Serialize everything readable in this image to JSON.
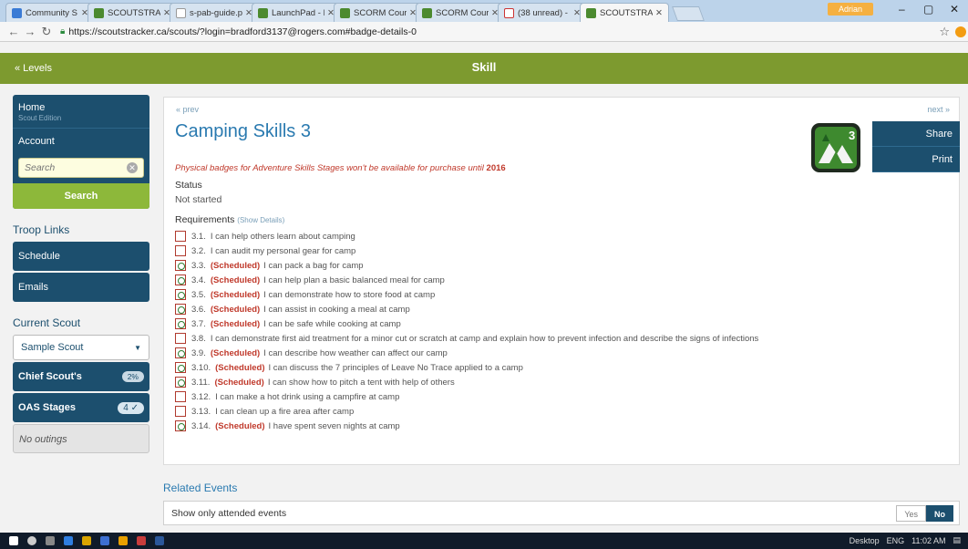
{
  "browser": {
    "tabs": [
      {
        "title": "Community S",
        "icon": "blue"
      },
      {
        "title": "SCOUTSTRAC",
        "icon": "green"
      },
      {
        "title": "s-pab-guide.p",
        "icon": "gray"
      },
      {
        "title": "LaunchPad - I",
        "icon": "green"
      },
      {
        "title": "SCORM Cours",
        "icon": "green"
      },
      {
        "title": "SCORM Cours",
        "icon": "green"
      },
      {
        "title": "(38 unread) -",
        "icon": "mail"
      },
      {
        "title": "SCOUTSTRAC",
        "icon": "green",
        "active": true
      }
    ],
    "profile": "Adrian",
    "url": "https://scoutstracker.ca/scouts/?login=bradford3137@rogers.com#badge-details-0"
  },
  "header": {
    "back": "« Levels",
    "title": "Skill"
  },
  "sidebar": {
    "home": "Home",
    "edition": "Scout Edition",
    "account": "Account",
    "search_placeholder": "Search",
    "search_button": "Search",
    "troop_links_heading": "Troop Links",
    "troop_links": [
      "Schedule",
      "Emails"
    ],
    "current_scout_heading": "Current Scout",
    "scout_selected": "Sample Scout",
    "chief_scouts": "Chief Scout's",
    "chief_scouts_pill": "2%",
    "oas_stages": "OAS Stages",
    "oas_pill": "4 ✓",
    "no_outings": "No outings"
  },
  "badge": {
    "prev": "« prev",
    "next": "next »",
    "title": "Camping Skills 3",
    "icon_stage": "3",
    "share": "Share",
    "print": "Print",
    "notice": "Physical badges for Adventure Skills Stages won't be available for purchase until",
    "notice_year": "2016",
    "status_label": "Status",
    "status_value": "Not started",
    "requirements_label": "Requirements",
    "show_details": "(Show Details)",
    "requirements": [
      {
        "num": "3.1.",
        "scheduled": false,
        "text": "I can help others learn about camping"
      },
      {
        "num": "3.2.",
        "scheduled": false,
        "text": "I can audit my personal gear for camp"
      },
      {
        "num": "3.3.",
        "scheduled": true,
        "text": "I can pack a bag for camp"
      },
      {
        "num": "3.4.",
        "scheduled": true,
        "text": "I can help plan a basic balanced meal for camp"
      },
      {
        "num": "3.5.",
        "scheduled": true,
        "text": "I can demonstrate how to store food at camp"
      },
      {
        "num": "3.6.",
        "scheduled": true,
        "text": "I can assist in cooking a meal at camp"
      },
      {
        "num": "3.7.",
        "scheduled": true,
        "text": "I can be safe while cooking at camp"
      },
      {
        "num": "3.8.",
        "scheduled": false,
        "text": "I can demonstrate first aid treatment for a minor cut or scratch at camp and explain how to prevent infection and describe the signs of infections"
      },
      {
        "num": "3.9.",
        "scheduled": true,
        "text": "I can describe how weather can affect our camp"
      },
      {
        "num": "3.10.",
        "scheduled": true,
        "text": "I can discuss the 7 principles of Leave No Trace applied to a camp"
      },
      {
        "num": "3.11.",
        "scheduled": true,
        "text": "I can show how to pitch a tent with help of others"
      },
      {
        "num": "3.12.",
        "scheduled": false,
        "text": "I can make a hot drink using a campfire at camp"
      },
      {
        "num": "3.13.",
        "scheduled": false,
        "text": "I can clean up a fire area after camp"
      },
      {
        "num": "3.14.",
        "scheduled": true,
        "text": "I have spent seven nights at camp"
      }
    ],
    "scheduled_label": "(Scheduled)"
  },
  "related": {
    "heading": "Related Events",
    "filter": "Show only attended events",
    "yes": "Yes",
    "no": "No"
  },
  "taskbar": {
    "desktop": "Desktop",
    "lang": "ENG",
    "time": "11:02 AM"
  },
  "colors": {
    "header_green": "#7d9a2f",
    "nav_blue": "#1c4f6e",
    "title_blue": "#2a7ab0",
    "scheduled_red": "#c0392b"
  }
}
